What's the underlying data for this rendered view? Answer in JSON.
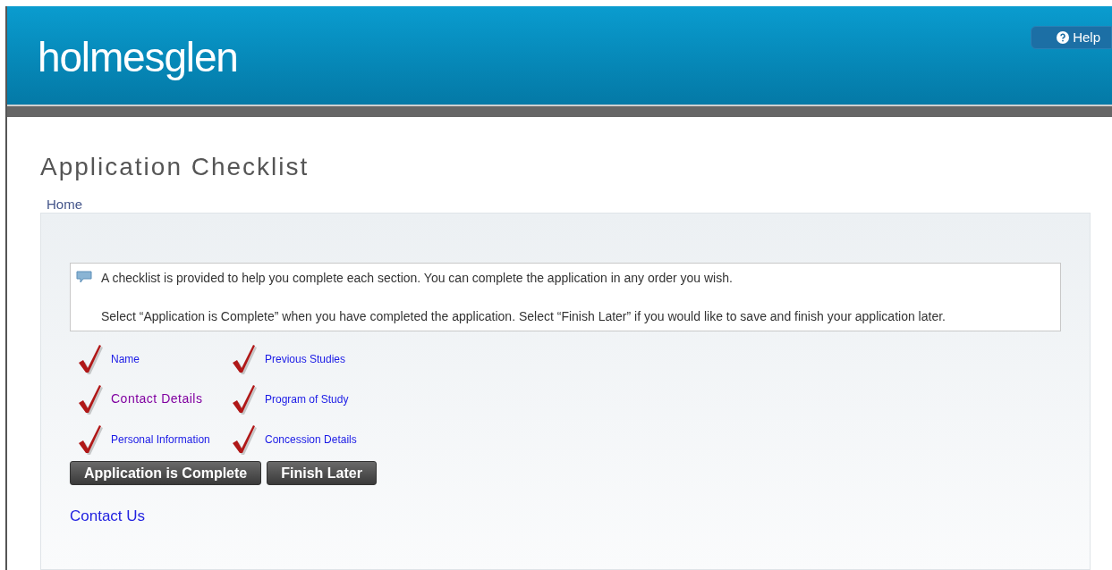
{
  "header": {
    "logo": "holmesglen",
    "help_button": "Help"
  },
  "page_title": "Application Checklist",
  "breadcrumb": "Home",
  "info": {
    "lines": [
      "A checklist is provided to help you complete each section. You can complete the application in any order you wish.",
      "Select “Application is Complete” when you have completed the application. Select “Finish Later” if you would like to save and finish your application later."
    ]
  },
  "checklist": [
    {
      "label": "Name",
      "checked": true,
      "visited": false
    },
    {
      "label": "Previous Studies",
      "checked": true,
      "visited": false
    },
    {
      "label": "Contact Details",
      "checked": true,
      "visited": true
    },
    {
      "label": "Program of Study",
      "checked": true,
      "visited": false
    },
    {
      "label": "Personal Information",
      "checked": true,
      "visited": false
    },
    {
      "label": "Concession Details",
      "checked": true,
      "visited": false
    }
  ],
  "buttons": [
    "Application is Complete",
    "Finish Later"
  ],
  "contact_link": "Contact Us"
}
